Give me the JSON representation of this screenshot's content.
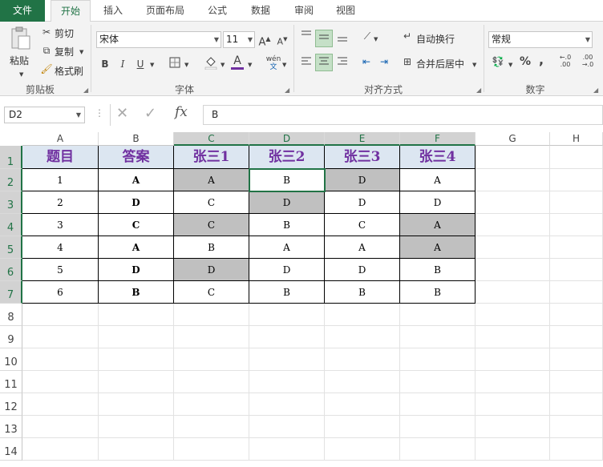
{
  "tabs": [
    {
      "label": "文件"
    },
    {
      "label": "开始"
    },
    {
      "label": "插入"
    },
    {
      "label": "页面布局"
    },
    {
      "label": "公式"
    },
    {
      "label": "数据"
    },
    {
      "label": "审阅"
    },
    {
      "label": "视图"
    }
  ],
  "ribbon": {
    "clipboard": {
      "paste": "粘贴",
      "cut": "剪切",
      "copy": "复制",
      "format_painter": "格式刷",
      "group": "剪贴板"
    },
    "font": {
      "name": "宋体",
      "size": "11",
      "bold": "B",
      "italic": "I",
      "underline": "U",
      "font_color": "A",
      "grow": "A",
      "shrink": "A",
      "phonetic": "wén",
      "group": "字体"
    },
    "align": {
      "wrap": "自动换行",
      "merge": "合并后居中",
      "group": "对齐方式"
    },
    "number": {
      "format": "常规",
      "percent": "%",
      "comma": ",",
      "inc_dec": ".0",
      "dec_dec": ".00",
      "group": "数字"
    }
  },
  "formula_bar": {
    "name_box": "D2",
    "fx": "fx",
    "value": "B"
  },
  "columns": [
    "A",
    "B",
    "C",
    "D",
    "E",
    "F",
    "G",
    "H"
  ],
  "rows": [
    "1",
    "2",
    "3",
    "4",
    "5",
    "6",
    "7",
    "8",
    "9",
    "10",
    "11",
    "12",
    "13",
    "14"
  ],
  "table": {
    "headers": [
      "题目",
      "答案",
      "张三1",
      "张三2",
      "张三3",
      "张三4"
    ],
    "rows": [
      [
        "1",
        "A",
        "A",
        "B",
        "D",
        "A"
      ],
      [
        "2",
        "D",
        "C",
        "D",
        "D",
        "D"
      ],
      [
        "3",
        "C",
        "C",
        "B",
        "C",
        "A"
      ],
      [
        "4",
        "A",
        "B",
        "A",
        "A",
        "A"
      ],
      [
        "5",
        "D",
        "D",
        "D",
        "D",
        "B"
      ],
      [
        "6",
        "B",
        "C",
        "B",
        "B",
        "B"
      ]
    ],
    "highlighted": [
      [
        1,
        2
      ],
      [
        1,
        4
      ],
      [
        2,
        3
      ],
      [
        3,
        2
      ],
      [
        3,
        5
      ],
      [
        4,
        5
      ],
      [
        5,
        2
      ]
    ]
  },
  "colors": {
    "accent": "#217346",
    "header_fill": "#dce6f1",
    "header_text": "#7030a0",
    "highlight": "#c0c0c0"
  }
}
